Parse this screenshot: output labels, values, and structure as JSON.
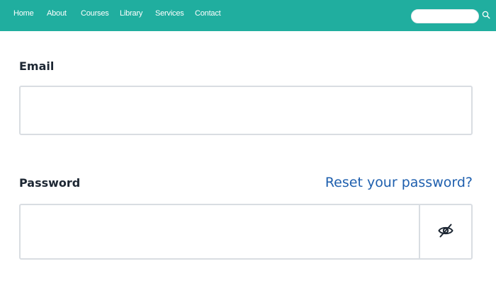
{
  "nav": {
    "items": [
      {
        "label": "Home"
      },
      {
        "label": "About"
      },
      {
        "label": "Courses"
      },
      {
        "label": "Library"
      },
      {
        "label": "Services"
      },
      {
        "label": "Contact"
      }
    ],
    "search": {
      "value": "",
      "icon": "search-icon"
    }
  },
  "form": {
    "email": {
      "label": "Email",
      "value": ""
    },
    "password": {
      "label": "Password",
      "value": "",
      "reset_link": "Reset your password?",
      "toggle_icon": "eye-off-icon"
    }
  },
  "colors": {
    "nav_bg": "#20ae9f",
    "link": "#1e5fae",
    "border": "#d9dde2",
    "label_text": "#1d2733"
  }
}
